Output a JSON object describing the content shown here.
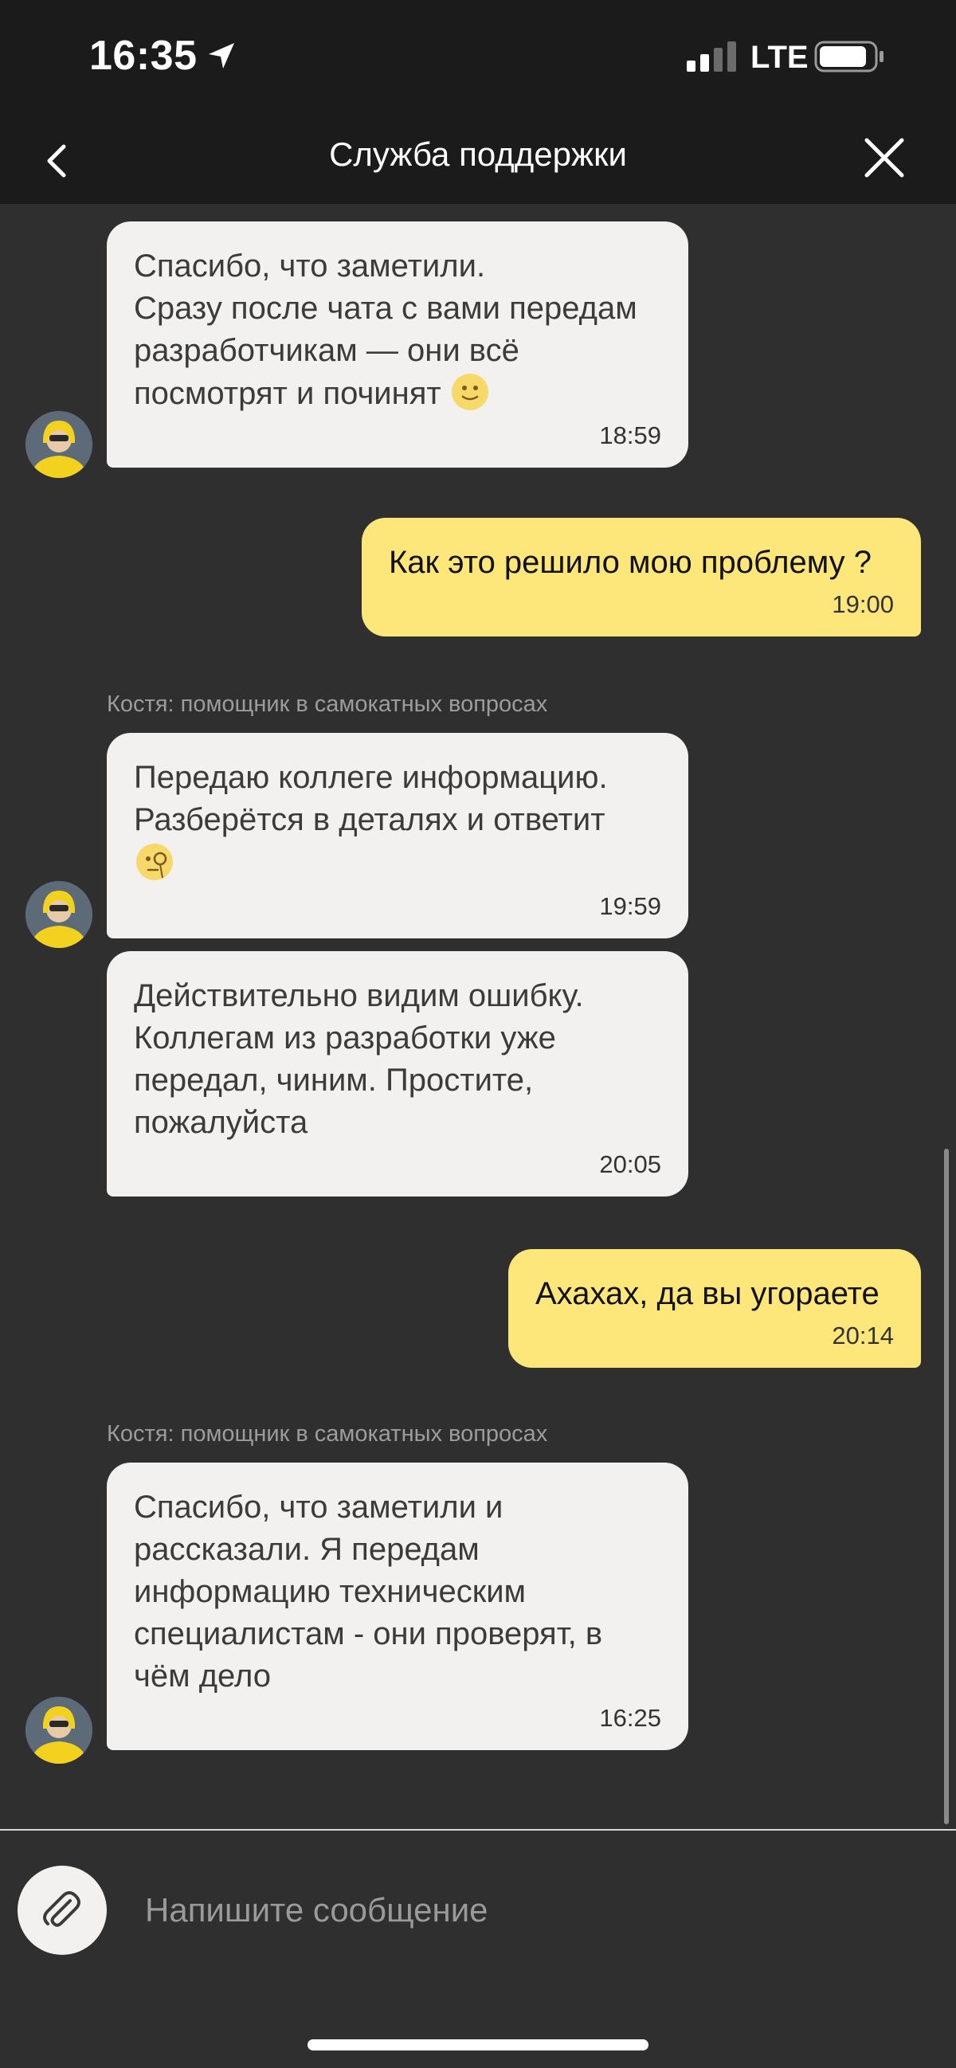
{
  "status_bar": {
    "time": "16:35",
    "network": "LTE",
    "icons": [
      "location-arrow-icon",
      "signal-icon",
      "battery-icon"
    ]
  },
  "header": {
    "title": "Служба поддержки",
    "back_icon": "chevron-left-icon",
    "close_icon": "close-icon"
  },
  "messages": [
    {
      "id": "m1",
      "direction": "incoming",
      "text": "Спасибо, что заметили.\nСразу после чата с вами передам разработчикам — они всё посмотрят и починят",
      "emoji": "slightly-smiling-face",
      "time": "18:59"
    },
    {
      "id": "m2",
      "direction": "outgoing",
      "text": "Как это решило мою проблему ?",
      "time": "19:00"
    },
    {
      "id": "m3",
      "direction": "incoming",
      "sender": "Костя: помощник в самокатных вопросах",
      "text": "Передаю коллеге информацию. Разберётся в деталях и ответит",
      "emoji": "face-with-monocle",
      "time": "19:59"
    },
    {
      "id": "m4",
      "direction": "incoming",
      "text": "Действительно видим ошибку. Коллегам из разработки уже передал, чиним. Простите, пожалуйста",
      "time": "20:05"
    },
    {
      "id": "m5",
      "direction": "outgoing",
      "text": "Ахахах, да вы угораете",
      "time": "20:14"
    },
    {
      "id": "m6",
      "direction": "incoming",
      "sender": "Костя: помощник в самокатных вопросах",
      "text": "Спасибо, что заметили и рассказали. Я передам информацию техническим специалистам - они проверят, в чём дело",
      "time": "16:25"
    }
  ],
  "composer": {
    "placeholder": "Напишите сообщение",
    "attach_icon": "paperclip-icon"
  },
  "colors": {
    "background": "#2f2f2f",
    "header": "#1b1b1b",
    "incoming_bubble": "#f2f1ef",
    "outgoing_bubble": "#fde77a"
  }
}
